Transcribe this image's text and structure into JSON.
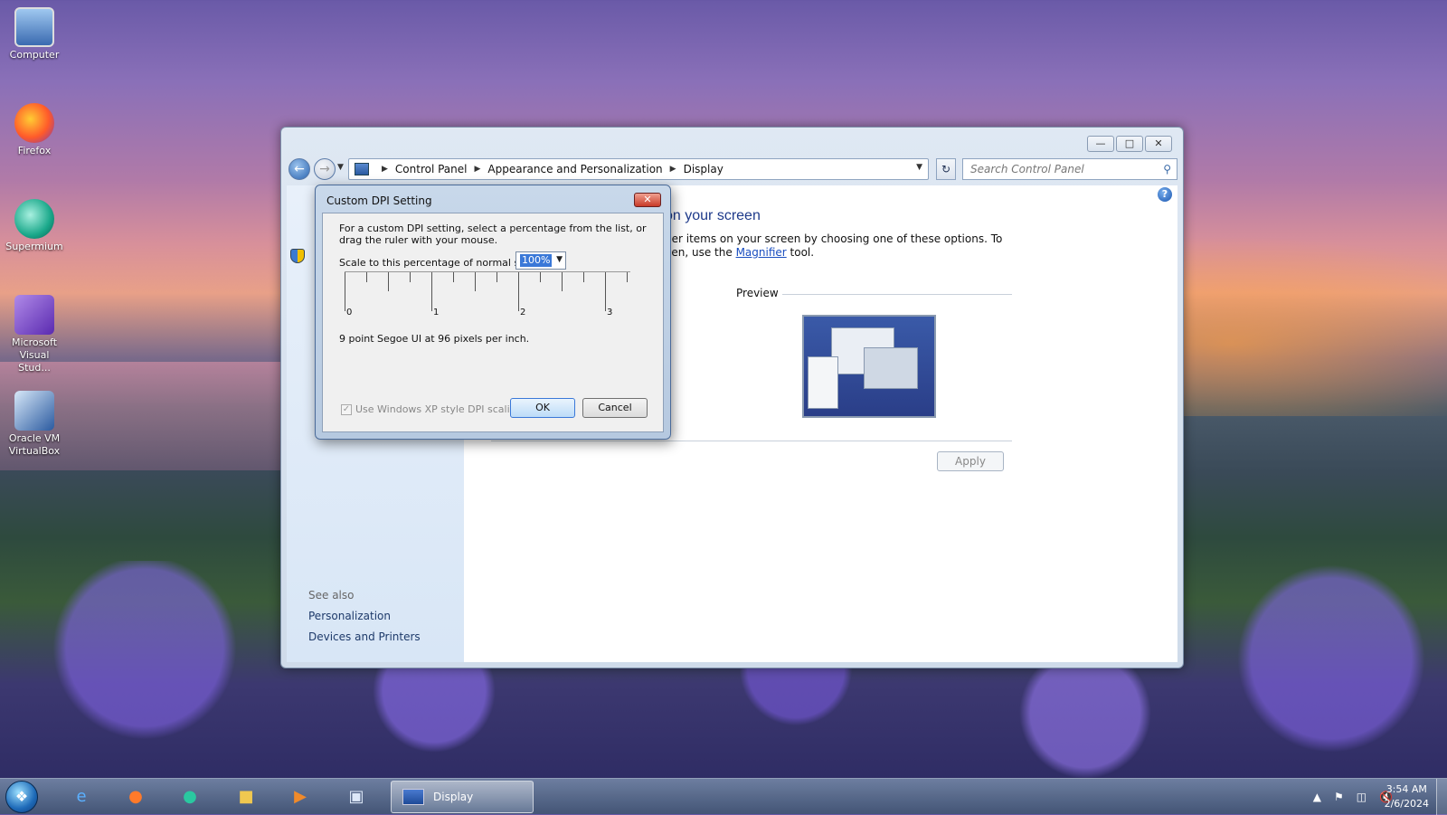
{
  "desktop": {
    "icons": [
      {
        "label": "Computer",
        "icon": "computer-icon"
      },
      {
        "label": "Firefox",
        "icon": "firefox-icon"
      },
      {
        "label": "Supermium",
        "icon": "supermium-icon"
      },
      {
        "label": "Microsoft Visual Stud...",
        "icon": "visual-studio-icon"
      },
      {
        "label": "Oracle VM VirtualBox",
        "icon": "virtualbox-icon"
      }
    ]
  },
  "window": {
    "breadcrumb": [
      "Control Panel",
      "Appearance and Personalization",
      "Display"
    ],
    "search_placeholder": "Search Control Panel",
    "heading": "on your screen",
    "description_line1": "her items on your screen by choosing one of these options. To",
    "description_line2_pre": "een, use the ",
    "description_link": "Magnifier",
    "description_line2_post": " tool.",
    "preview_label": "Preview",
    "apply_label": "Apply",
    "see_also": "See also",
    "links": [
      "Personalization",
      "Devices and Printers"
    ]
  },
  "dialog": {
    "title": "Custom DPI Setting",
    "instruction_line1": "For a custom DPI setting, select a percentage from the list, or",
    "instruction_line2": "drag the ruler with your mouse.",
    "scale_label": "Scale to this percentage of normal size:",
    "scale_value": "100%",
    "ruler_numbers": [
      "0",
      "1",
      "2",
      "3"
    ],
    "font_description": "9 point Segoe UI at 96 pixels per inch.",
    "xp_scaling_label": "Use Windows XP style DPI scaling",
    "xp_scaling_checked": true,
    "ok_label": "OK",
    "cancel_label": "Cancel"
  },
  "taskbar": {
    "active_task": "Display",
    "pinned": [
      "internet-explorer-icon",
      "firefox-icon",
      "supermium-icon",
      "file-explorer-icon",
      "media-player-icon",
      "virtualbox-icon"
    ],
    "time": "3:54 AM",
    "date": "2/6/2024"
  },
  "colors": {
    "link": "#1a4ec0",
    "heading": "#1e3a8a",
    "selection": "#3a78d8"
  }
}
